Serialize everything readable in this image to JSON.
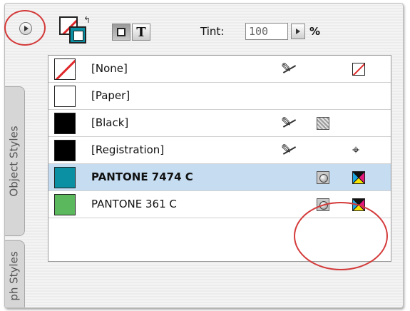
{
  "toolbar": {
    "menu_icon": "panel-menu-triangle-icon",
    "fill_stroke_icon": "fill-stroke-swatch-icon",
    "swap_icon": "swap-arrow-icon",
    "container_button_icon": "formatting-container-icon",
    "text_button_label": "T",
    "tint_label": "Tint:",
    "tint_value": "100",
    "tint_unit": "%"
  },
  "side_tabs": {
    "object_styles": "Object Styles",
    "paragraph_styles": "ph Styles"
  },
  "swatches": [
    {
      "name": "[None]",
      "color": "#ffffff",
      "locked": true,
      "mode": "",
      "type": "none"
    },
    {
      "name": "[Paper]",
      "color": "#ffffff",
      "locked": false,
      "mode": "",
      "type": ""
    },
    {
      "name": "[Black]",
      "color": "#000000",
      "locked": true,
      "mode": "grayscale",
      "type": ""
    },
    {
      "name": "[Registration]",
      "color": "#000000",
      "locked": true,
      "mode": "",
      "type": "registration"
    },
    {
      "name": "PANTONE 7474 C",
      "color": "#0b8fa3",
      "locked": false,
      "mode": "spot",
      "type": "cmyk",
      "selected": true
    },
    {
      "name": "PANTONE 361 C",
      "color": "#5cb85c",
      "locked": false,
      "mode": "spot",
      "type": "cmyk"
    }
  ],
  "colors": {
    "selection_highlight": "#c6dcf1",
    "annotation_circle": "#d43a3a",
    "none_slash": "#e0282a"
  }
}
